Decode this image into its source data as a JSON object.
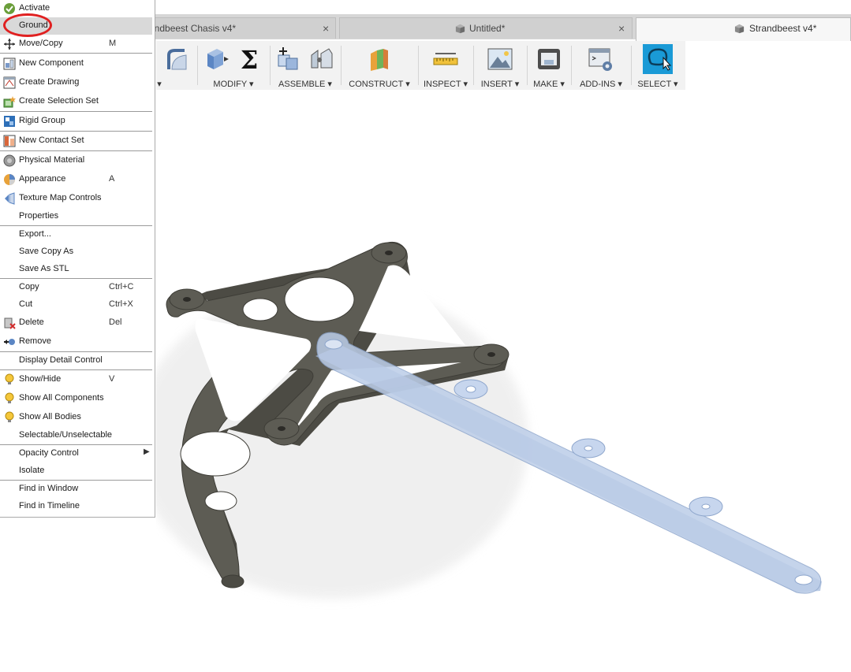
{
  "tabs": [
    {
      "label": "andbeest Chasis v4*",
      "close": "×"
    },
    {
      "label": "Untitled*",
      "close": "×"
    },
    {
      "label": "Strandbeest v4*"
    }
  ],
  "toolbar": {
    "groups": [
      {
        "label": "MODIFY ▾"
      },
      {
        "label": "ASSEMBLE ▾"
      },
      {
        "label": "CONSTRUCT ▾"
      },
      {
        "label": "INSPECT ▾"
      },
      {
        "label": "INSERT ▾"
      },
      {
        "label": "MAKE ▾"
      },
      {
        "label": "ADD-INS ▾"
      },
      {
        "label": "SELECT ▾"
      }
    ],
    "partial_dropdown": "▾",
    "sigma": "Σ"
  },
  "menu": {
    "items": [
      {
        "label": "Activate",
        "shortcut": "",
        "icon": "check-circle-icon"
      },
      {
        "label": "Ground",
        "shortcut": "",
        "icon": "",
        "highlighted": true
      },
      {
        "label": "Move/Copy",
        "shortcut": "M",
        "icon": "move-icon"
      },
      {
        "label": "New Component",
        "shortcut": "",
        "icon": "new-component-icon"
      },
      {
        "label": "Create Drawing",
        "shortcut": "",
        "icon": "create-drawing-icon"
      },
      {
        "label": "Create Selection Set",
        "shortcut": "",
        "icon": "selection-set-icon"
      },
      {
        "label": "Rigid Group",
        "shortcut": "",
        "icon": "rigid-group-icon"
      },
      {
        "label": "New Contact Set",
        "shortcut": "",
        "icon": "contact-set-icon"
      },
      {
        "label": "Physical Material",
        "shortcut": "",
        "icon": "physical-material-icon"
      },
      {
        "label": "Appearance",
        "shortcut": "A",
        "icon": "appearance-icon"
      },
      {
        "label": "Texture Map Controls",
        "shortcut": "",
        "icon": "texture-map-icon"
      },
      {
        "label": "Properties",
        "shortcut": "",
        "icon": ""
      },
      {
        "label": "Export...",
        "shortcut": "",
        "icon": ""
      },
      {
        "label": "Save Copy As",
        "shortcut": "",
        "icon": ""
      },
      {
        "label": "Save As STL",
        "shortcut": "",
        "icon": ""
      },
      {
        "label": "Copy",
        "shortcut": "Ctrl+C",
        "icon": ""
      },
      {
        "label": "Cut",
        "shortcut": "Ctrl+X",
        "icon": ""
      },
      {
        "label": "Delete",
        "shortcut": "Del",
        "icon": "delete-icon"
      },
      {
        "label": "Remove",
        "shortcut": "",
        "icon": "remove-icon"
      },
      {
        "label": "Display Detail Control",
        "shortcut": "",
        "icon": ""
      },
      {
        "label": "Show/Hide",
        "shortcut": "V",
        "icon": "lightbulb-icon"
      },
      {
        "label": "Show All Components",
        "shortcut": "",
        "icon": "lightbulb-icon"
      },
      {
        "label": "Show All Bodies",
        "shortcut": "",
        "icon": "lightbulb-icon"
      },
      {
        "label": "Selectable/Unselectable",
        "shortcut": "",
        "icon": ""
      },
      {
        "label": "Opacity Control",
        "shortcut": "",
        "icon": "",
        "submenu": true
      },
      {
        "label": "Isolate",
        "shortcut": "",
        "icon": ""
      },
      {
        "label": "Find in Window",
        "shortcut": "",
        "icon": ""
      },
      {
        "label": "Find in Timeline",
        "shortcut": "",
        "icon": ""
      }
    ],
    "submenu_arrow": "▶"
  },
  "colors": {
    "highlight_circle": "#e02020",
    "chassis": "#5b5a52",
    "link": "#b7c9e6",
    "select_accent": "#1a9ad6"
  }
}
